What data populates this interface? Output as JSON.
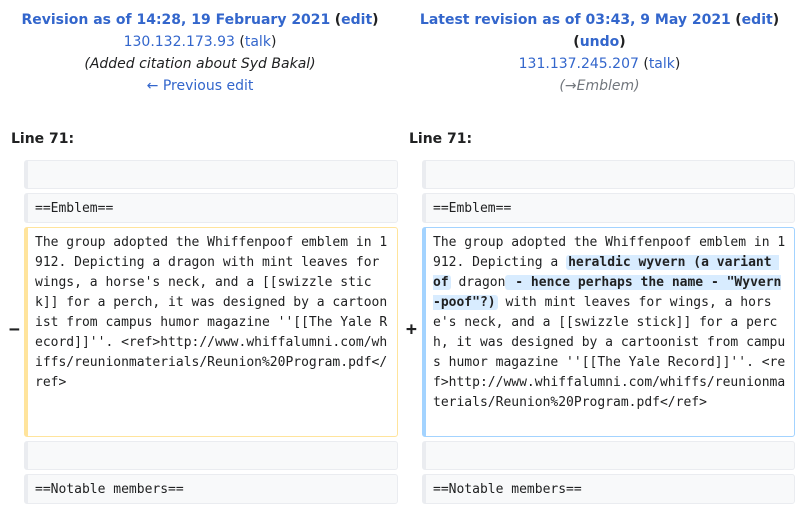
{
  "left_header": {
    "title_link": "Revision as of 14:28, 19 February 2021",
    "edit_link": "edit",
    "user_link": "130.132.173.93",
    "talk_link": "talk",
    "summary": "(Added citation about Syd Bakal)",
    "prev_link": "← Previous edit"
  },
  "right_header": {
    "title_link": "Latest revision as of 03:43, 9 May 2021",
    "edit_link": "edit",
    "undo_link": "undo",
    "user_link": "131.137.245.207",
    "talk_link": "talk",
    "summary_arrow": "→Emblem"
  },
  "left_lineno": "Line 71:",
  "right_lineno": "Line 71:",
  "rows": {
    "row2_left": "==Emblem==",
    "row2_right": "==Emblem==",
    "deleted_text": "The group adopted the Whiffenpoof emblem in 1912. Depicting a dragon with mint leaves for wings, a horse's neck, and a [[swizzle stick]] for a perch, it was designed by a cartoonist from campus humor magazine ''[[The Yale Record]]''. <ref>http://www.whiffalumni.com/whiffs/reunionmaterials/Reunion%20Program.pdf</ref>",
    "added_text_part1": "The group adopted the Whiffenpoof emblem in 1912. Depicting a ",
    "added_ins1": "heraldic wyvern (a variant of",
    "added_text_part2": " dragon",
    "added_ins2": " - hence perhaps the name - \"Wyvern-poof\"?)",
    "added_text_part3": " with mint leaves for wings, a horse's neck, and a [[swizzle stick]] for a perch, it was designed by a cartoonist from campus humor magazine ''[[The Yale Record]]''. <ref>http://www.whiffalumni.com/whiffs/reunionmaterials/Reunion%20Program.pdf</ref>",
    "row5_left": "==Notable members==",
    "row5_right": "==Notable members=="
  },
  "markers": {
    "minus": "−",
    "plus": "+"
  }
}
